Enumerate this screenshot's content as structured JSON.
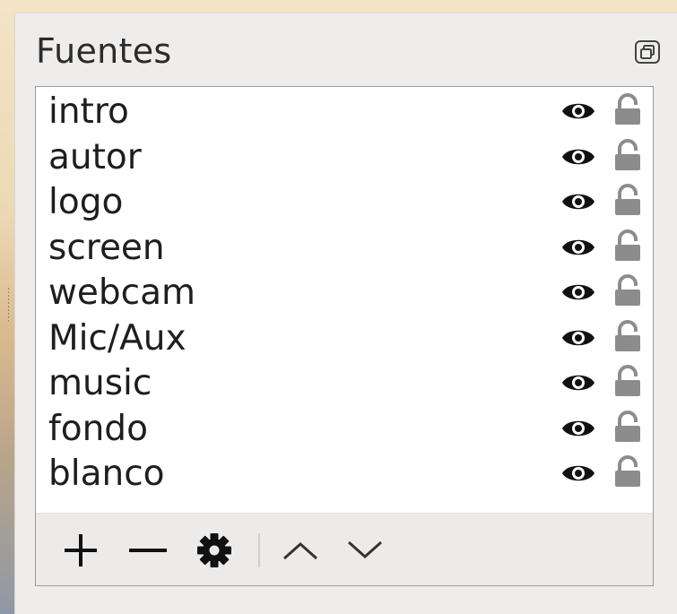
{
  "dock": {
    "title": "Fuentes",
    "float_icon": "float-icon"
  },
  "sources": [
    {
      "label": "intro",
      "visibility_icon": "eye-icon",
      "lock_icon": "unlocked-icon",
      "visible": true,
      "locked": false
    },
    {
      "label": "autor",
      "visibility_icon": "eye-icon",
      "lock_icon": "unlocked-icon",
      "visible": true,
      "locked": false
    },
    {
      "label": "logo",
      "visibility_icon": "eye-icon",
      "lock_icon": "unlocked-icon",
      "visible": true,
      "locked": false
    },
    {
      "label": "screen",
      "visibility_icon": "eye-icon",
      "lock_icon": "unlocked-icon",
      "visible": true,
      "locked": false
    },
    {
      "label": "webcam",
      "visibility_icon": "eye-icon",
      "lock_icon": "unlocked-icon",
      "visible": true,
      "locked": false
    },
    {
      "label": "Mic/Aux",
      "visibility_icon": "eye-icon",
      "lock_icon": "unlocked-icon",
      "visible": true,
      "locked": false
    },
    {
      "label": "music",
      "visibility_icon": "eye-icon",
      "lock_icon": "unlocked-icon",
      "visible": true,
      "locked": false
    },
    {
      "label": "fondo",
      "visibility_icon": "eye-icon",
      "lock_icon": "unlocked-icon",
      "visible": true,
      "locked": false
    },
    {
      "label": "blanco",
      "visibility_icon": "eye-icon",
      "lock_icon": "unlocked-icon",
      "visible": true,
      "locked": false
    }
  ],
  "toolbar": {
    "buttons": [
      "plus-icon",
      "minus-icon",
      "gear-icon",
      "chevron-up-icon",
      "chevron-down-icon"
    ]
  },
  "colors": {
    "dock_bg": "#efedeb",
    "list_bg": "#ffffff",
    "icon_dark": "#111111",
    "lock_gray": "#8c8c8c"
  }
}
